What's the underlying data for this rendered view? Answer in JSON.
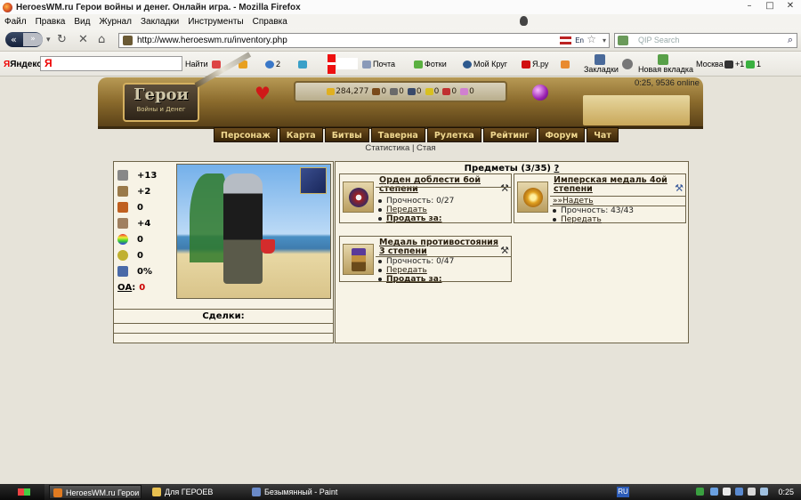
{
  "window": {
    "title": "HeroesWM.ru Герои войны и денег. Онлайн игра. - Mozilla Firefox",
    "minimize": "–",
    "maximize": "□",
    "close": "✕"
  },
  "menu": [
    "Файл",
    "Правка",
    "Вид",
    "Журнал",
    "Закладки",
    "Инструменты",
    "Справка"
  ],
  "nav": {
    "url": "http://www.heroeswm.ru/inventory.php",
    "lang": "En",
    "search_placeholder": "QIP Search"
  },
  "yandex": {
    "logo": "Яндекс",
    "search_button": "Найти",
    "comments_count": "2",
    "mail": "Почта",
    "photos": "Фотки",
    "my_circle": "Мой Круг",
    "yaru": "Я.ру",
    "bookmarks": "Закладки",
    "new_tab": "Новая вкладка",
    "city": "Москва",
    "temp": "+1",
    "count": "1"
  },
  "game": {
    "online": "0:25, 9536 online",
    "logo_line1": "Герои",
    "logo_line2": "Войны и Денег",
    "resources": {
      "gold": "284,277",
      "wood": "0",
      "ore": "0",
      "mercury": "0",
      "sulfur": "0",
      "crystals": "0",
      "gems": "0"
    },
    "nav": [
      "Персонаж",
      "Карта",
      "Битвы",
      "Таверна",
      "Рулетка",
      "Рейтинг",
      "Форум",
      "Чат"
    ],
    "subnav": {
      "stats": "Статистика",
      "sep": "|",
      "flock": "Стая"
    },
    "stats": [
      {
        "icon": "attack-icon",
        "value": "+13"
      },
      {
        "icon": "defense-icon",
        "value": "+2"
      },
      {
        "icon": "spellpower-icon",
        "value": "0"
      },
      {
        "icon": "knowledge-icon",
        "value": "+4"
      },
      {
        "icon": "luck-icon",
        "value": "0"
      },
      {
        "icon": "morale-icon",
        "value": "0"
      },
      {
        "icon": "mana-icon",
        "value": "0%"
      }
    ],
    "oa_label": "ОА",
    "oa_colon": ":",
    "oa_value": "0",
    "deals_label": "Сделки:",
    "items_title": "Предметы (3/35)",
    "items_help": "?",
    "items": [
      {
        "name": "Орден доблести 6ой степени",
        "durability": "Прочность: 0/27",
        "transfer": "Передать",
        "sell": "Продать за:"
      },
      {
        "name": "Имперская медаль 4ой степени",
        "wear": "»»Надеть",
        "durability": "Прочность: 43/43",
        "transfer": "Передать"
      },
      {
        "name": "Медаль противостояния 3 степени",
        "durability": "Прочность: 0/47",
        "transfer": "Передать",
        "sell": "Продать за:"
      }
    ]
  },
  "taskbar": {
    "tasks": [
      "HeroesWM.ru Герои ...",
      "Для ГЕРОЕВ",
      "Безымянный - Paint"
    ],
    "lang": "RU",
    "clock": "0:25"
  }
}
